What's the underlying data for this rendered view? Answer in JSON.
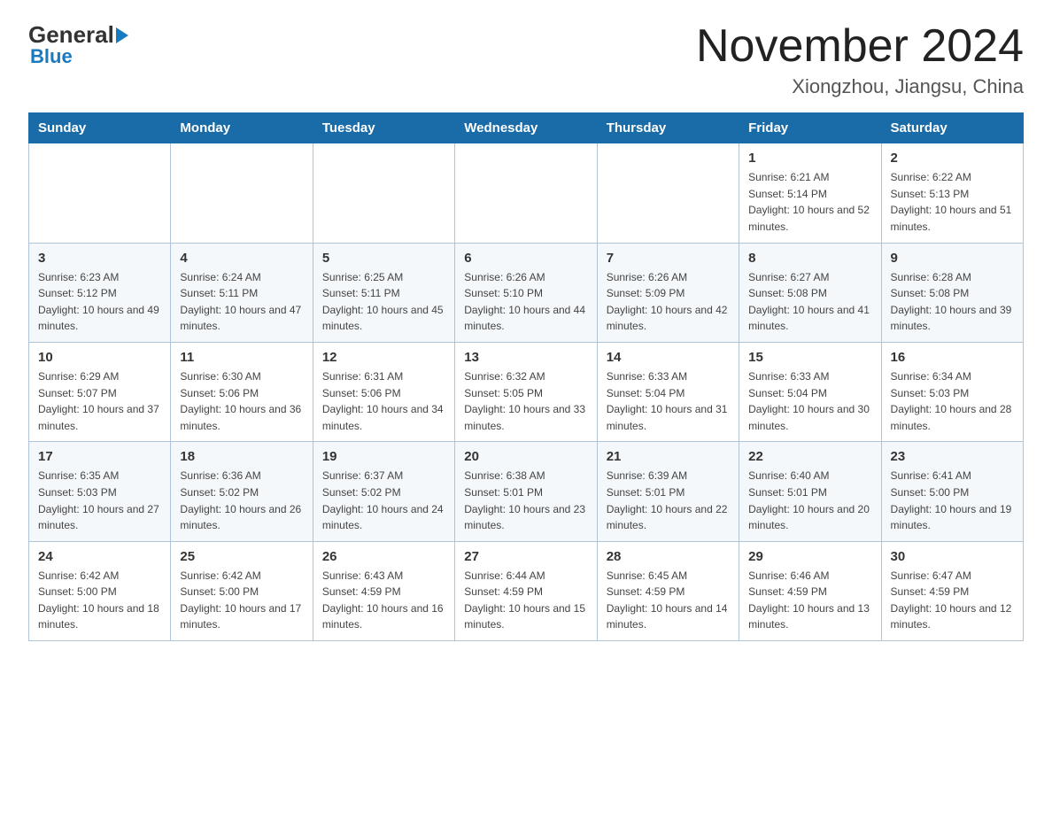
{
  "logo": {
    "general": "General",
    "blue": "Blue"
  },
  "header": {
    "month": "November 2024",
    "location": "Xiongzhou, Jiangsu, China"
  },
  "days_of_week": [
    "Sunday",
    "Monday",
    "Tuesday",
    "Wednesday",
    "Thursday",
    "Friday",
    "Saturday"
  ],
  "weeks": [
    [
      {
        "day": "",
        "info": ""
      },
      {
        "day": "",
        "info": ""
      },
      {
        "day": "",
        "info": ""
      },
      {
        "day": "",
        "info": ""
      },
      {
        "day": "",
        "info": ""
      },
      {
        "day": "1",
        "info": "Sunrise: 6:21 AM\nSunset: 5:14 PM\nDaylight: 10 hours and 52 minutes."
      },
      {
        "day": "2",
        "info": "Sunrise: 6:22 AM\nSunset: 5:13 PM\nDaylight: 10 hours and 51 minutes."
      }
    ],
    [
      {
        "day": "3",
        "info": "Sunrise: 6:23 AM\nSunset: 5:12 PM\nDaylight: 10 hours and 49 minutes."
      },
      {
        "day": "4",
        "info": "Sunrise: 6:24 AM\nSunset: 5:11 PM\nDaylight: 10 hours and 47 minutes."
      },
      {
        "day": "5",
        "info": "Sunrise: 6:25 AM\nSunset: 5:11 PM\nDaylight: 10 hours and 45 minutes."
      },
      {
        "day": "6",
        "info": "Sunrise: 6:26 AM\nSunset: 5:10 PM\nDaylight: 10 hours and 44 minutes."
      },
      {
        "day": "7",
        "info": "Sunrise: 6:26 AM\nSunset: 5:09 PM\nDaylight: 10 hours and 42 minutes."
      },
      {
        "day": "8",
        "info": "Sunrise: 6:27 AM\nSunset: 5:08 PM\nDaylight: 10 hours and 41 minutes."
      },
      {
        "day": "9",
        "info": "Sunrise: 6:28 AM\nSunset: 5:08 PM\nDaylight: 10 hours and 39 minutes."
      }
    ],
    [
      {
        "day": "10",
        "info": "Sunrise: 6:29 AM\nSunset: 5:07 PM\nDaylight: 10 hours and 37 minutes."
      },
      {
        "day": "11",
        "info": "Sunrise: 6:30 AM\nSunset: 5:06 PM\nDaylight: 10 hours and 36 minutes."
      },
      {
        "day": "12",
        "info": "Sunrise: 6:31 AM\nSunset: 5:06 PM\nDaylight: 10 hours and 34 minutes."
      },
      {
        "day": "13",
        "info": "Sunrise: 6:32 AM\nSunset: 5:05 PM\nDaylight: 10 hours and 33 minutes."
      },
      {
        "day": "14",
        "info": "Sunrise: 6:33 AM\nSunset: 5:04 PM\nDaylight: 10 hours and 31 minutes."
      },
      {
        "day": "15",
        "info": "Sunrise: 6:33 AM\nSunset: 5:04 PM\nDaylight: 10 hours and 30 minutes."
      },
      {
        "day": "16",
        "info": "Sunrise: 6:34 AM\nSunset: 5:03 PM\nDaylight: 10 hours and 28 minutes."
      }
    ],
    [
      {
        "day": "17",
        "info": "Sunrise: 6:35 AM\nSunset: 5:03 PM\nDaylight: 10 hours and 27 minutes."
      },
      {
        "day": "18",
        "info": "Sunrise: 6:36 AM\nSunset: 5:02 PM\nDaylight: 10 hours and 26 minutes."
      },
      {
        "day": "19",
        "info": "Sunrise: 6:37 AM\nSunset: 5:02 PM\nDaylight: 10 hours and 24 minutes."
      },
      {
        "day": "20",
        "info": "Sunrise: 6:38 AM\nSunset: 5:01 PM\nDaylight: 10 hours and 23 minutes."
      },
      {
        "day": "21",
        "info": "Sunrise: 6:39 AM\nSunset: 5:01 PM\nDaylight: 10 hours and 22 minutes."
      },
      {
        "day": "22",
        "info": "Sunrise: 6:40 AM\nSunset: 5:01 PM\nDaylight: 10 hours and 20 minutes."
      },
      {
        "day": "23",
        "info": "Sunrise: 6:41 AM\nSunset: 5:00 PM\nDaylight: 10 hours and 19 minutes."
      }
    ],
    [
      {
        "day": "24",
        "info": "Sunrise: 6:42 AM\nSunset: 5:00 PM\nDaylight: 10 hours and 18 minutes."
      },
      {
        "day": "25",
        "info": "Sunrise: 6:42 AM\nSunset: 5:00 PM\nDaylight: 10 hours and 17 minutes."
      },
      {
        "day": "26",
        "info": "Sunrise: 6:43 AM\nSunset: 4:59 PM\nDaylight: 10 hours and 16 minutes."
      },
      {
        "day": "27",
        "info": "Sunrise: 6:44 AM\nSunset: 4:59 PM\nDaylight: 10 hours and 15 minutes."
      },
      {
        "day": "28",
        "info": "Sunrise: 6:45 AM\nSunset: 4:59 PM\nDaylight: 10 hours and 14 minutes."
      },
      {
        "day": "29",
        "info": "Sunrise: 6:46 AM\nSunset: 4:59 PM\nDaylight: 10 hours and 13 minutes."
      },
      {
        "day": "30",
        "info": "Sunrise: 6:47 AM\nSunset: 4:59 PM\nDaylight: 10 hours and 12 minutes."
      }
    ]
  ]
}
